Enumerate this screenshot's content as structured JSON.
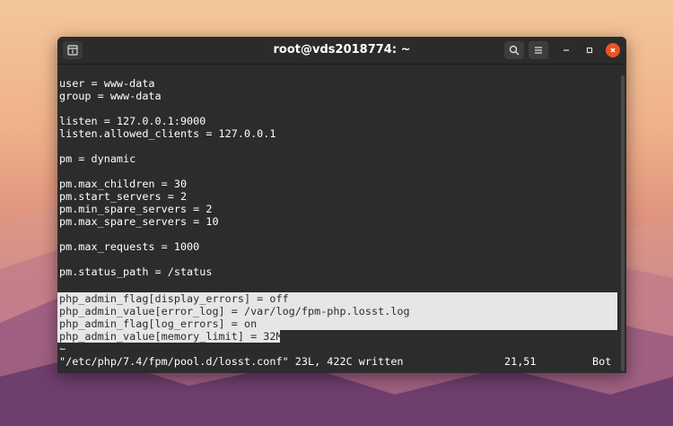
{
  "window": {
    "title": "root@vds2018774: ~"
  },
  "titlebar_icons": {
    "new_tab": "new-tab-icon",
    "search": "search-icon",
    "menu": "hamburger-menu-icon",
    "minimize": "minimize-icon",
    "maximize": "maximize-icon",
    "close": "close-icon"
  },
  "terminal": {
    "lines": [
      "user = www-data",
      "group = www-data",
      "",
      "listen = 127.0.0.1:9000",
      "listen.allowed_clients = 127.0.0.1",
      "",
      "pm = dynamic",
      "",
      "pm.max_children = 30",
      "pm.start_servers = 2",
      "pm.min_spare_servers = 2",
      "pm.max_spare_servers = 10",
      "",
      "pm.max_requests = 1000",
      "",
      "pm.status_path = /status",
      "",
      "php_admin_flag[display_errors] = off",
      "php_admin_value[error_log] = /var/log/fpm-php.losst.log",
      "php_admin_flag[log_errors] = on",
      "php_admin_value[memory_limit] = 32M",
      "~"
    ],
    "status_file": "\"/etc/php/7.4/fpm/pool.d/losst.conf\" 23L, 422C written",
    "status_position": "21,51",
    "status_scroll": "Bot"
  },
  "colors": {
    "terminal_bg": "#2c2c2c",
    "titlebar_bg": "#2b2b2b",
    "selection_bg": "#e6e6e6",
    "close_button": "#e95420"
  }
}
